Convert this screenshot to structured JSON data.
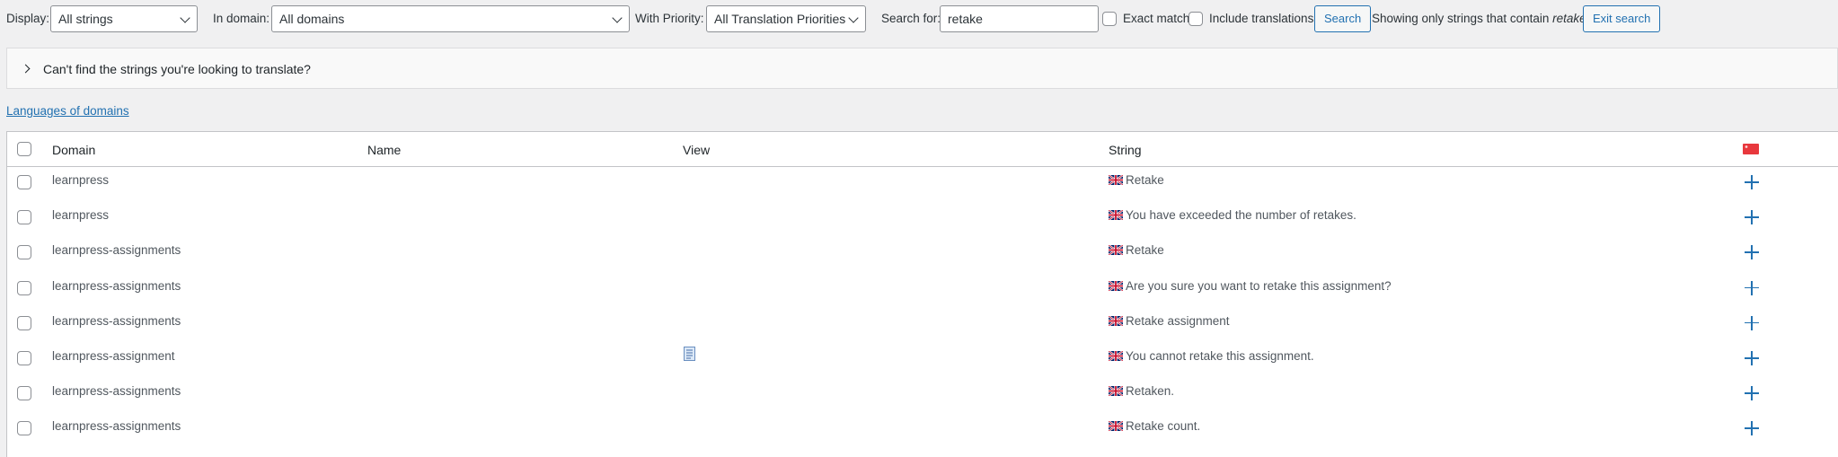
{
  "filters": {
    "display_label": "Display:",
    "display_value": "All strings",
    "domain_label": "In domain:",
    "domain_value": "All domains",
    "priority_label": "With Priority:",
    "priority_value": "All Translation Priorities",
    "search_label": "Search for:",
    "search_value": "retake",
    "exact_match_label": "Exact match",
    "include_translations_label": "Include translations",
    "search_button": "Search",
    "showing_prefix": "Showing only strings that contain",
    "showing_term": "retake",
    "exit_button": "Exit search"
  },
  "help": {
    "text": "Can't find the strings you're looking to translate?"
  },
  "links": {
    "languages_of_domains": "Languages of domains"
  },
  "table": {
    "headers": {
      "domain": "Domain",
      "name": "Name",
      "view": "View",
      "string": "String"
    },
    "rows": [
      {
        "domain": "learnpress",
        "string": "Retake"
      },
      {
        "domain": "learnpress",
        "string": "You have exceeded the number of retakes."
      },
      {
        "domain": "learnpress-assignments",
        "string": "Retake"
      },
      {
        "domain": "learnpress-assignments",
        "string": "Are you sure you want to retake this assignment?"
      },
      {
        "domain": "learnpress-assignments",
        "string": "Retake assignment"
      },
      {
        "domain": "learnpress-assignment",
        "string": "You cannot retake this assignment.",
        "has_view_icon": true
      },
      {
        "domain": "learnpress-assignments",
        "string": "Retaken."
      },
      {
        "domain": "learnpress-assignments",
        "string": "Retake count."
      }
    ]
  },
  "colors": {
    "accent": "#2271b1",
    "target_flag": "#e8383d"
  }
}
